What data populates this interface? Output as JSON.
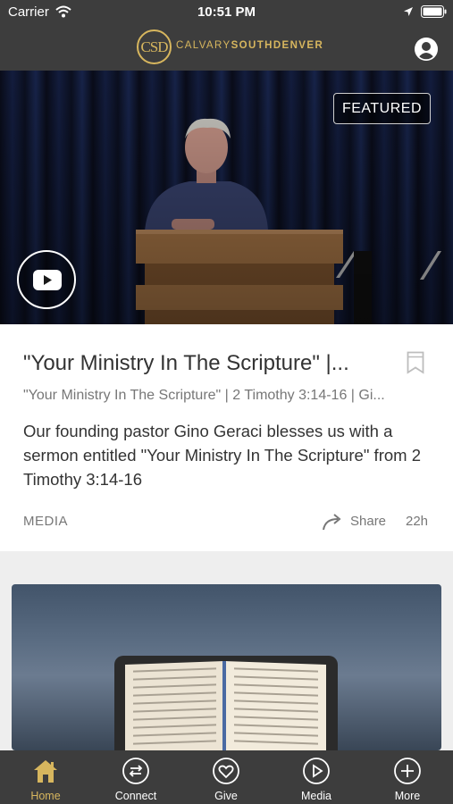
{
  "status_bar": {
    "carrier": "Carrier",
    "time": "10:51 PM"
  },
  "header": {
    "logo_badge": "CSD",
    "logo_text_light": "CALVARY",
    "logo_text_bold": "SOUTHDENVER",
    "accent_color": "#d7b65e",
    "bar_color": "#3d3d3d"
  },
  "featured": {
    "badge": "FEATURED",
    "title": "\"Your Ministry In The Scripture\" |...",
    "subtitle": "\"Your Ministry In The Scripture\" | 2 Timothy 3:14-16 | Gi...",
    "description": "Our founding pastor Gino Geraci blesses us with a sermon entitled \"Your Ministry In The Scripture\" from 2 Timothy 3:14-16",
    "category": "MEDIA",
    "share_label": "Share",
    "time_ago": "22h"
  },
  "icons": {
    "wifi": "wifi-icon",
    "location": "location-arrow-icon",
    "battery": "battery-icon",
    "profile": "user-icon",
    "play": "youtube-play-icon",
    "bookmark": "bookmark-icon",
    "share": "share-arrow-icon"
  },
  "tabs": [
    {
      "label": "Home",
      "icon": "home-icon",
      "active": true
    },
    {
      "label": "Connect",
      "icon": "connect-icon",
      "active": false
    },
    {
      "label": "Give",
      "icon": "heart-icon",
      "active": false
    },
    {
      "label": "Media",
      "icon": "play-circle-icon",
      "active": false
    },
    {
      "label": "More",
      "icon": "plus-circle-icon",
      "active": false
    }
  ]
}
